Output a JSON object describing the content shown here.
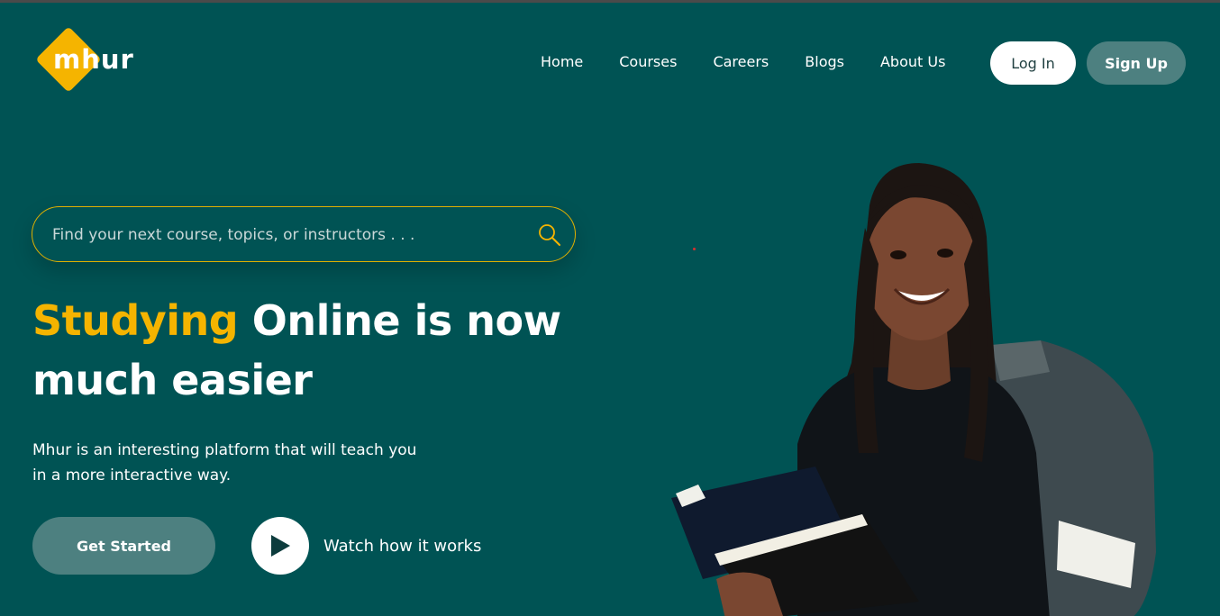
{
  "brand": {
    "name": "mhur",
    "accent_color": "#f5b400"
  },
  "nav": {
    "items": [
      {
        "label": "Home"
      },
      {
        "label": "Courses"
      },
      {
        "label": "Careers"
      },
      {
        "label": "Blogs"
      },
      {
        "label": "About Us"
      }
    ],
    "login_label": "Log In",
    "signup_label": "Sign Up"
  },
  "search": {
    "placeholder": "Find your next course, topics, or instructors . . .",
    "icon": "search-icon"
  },
  "hero": {
    "headline_accent": "Studying",
    "headline_rest_line1": "Online is now",
    "headline_line2": "much easier",
    "description": "Mhur is an interesting platform that will teach you in a more interactive way.",
    "cta_label": "Get Started",
    "watch_label": "Watch how it works",
    "image": "student-with-books-and-backpack-photo"
  },
  "colors": {
    "background": "#005354",
    "accent": "#f5b400",
    "button_muted": "#4d8080"
  }
}
